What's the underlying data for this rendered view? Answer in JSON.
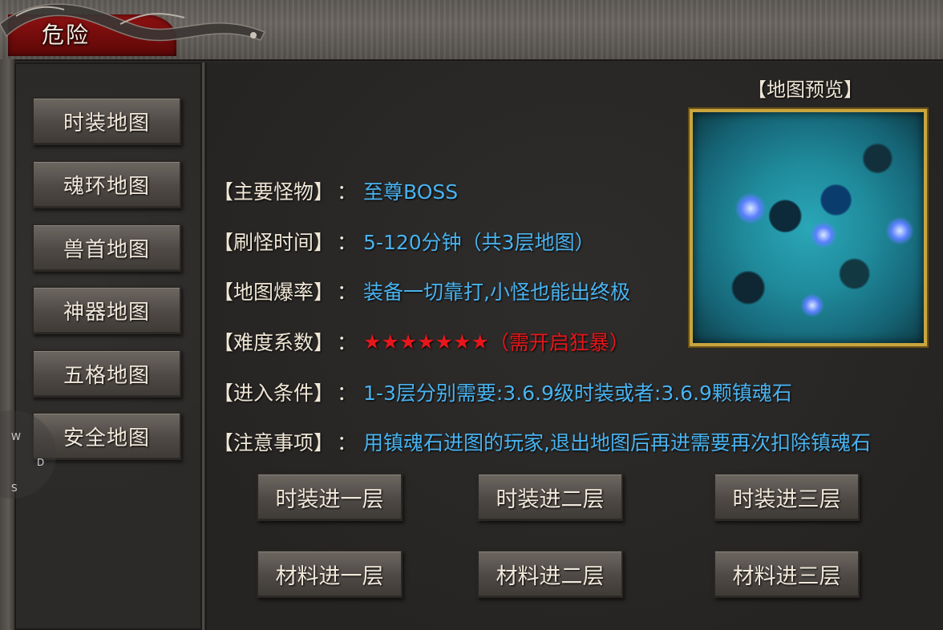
{
  "window": {
    "title": "危险"
  },
  "sidebar": {
    "items": [
      {
        "label": "时装地图"
      },
      {
        "label": "魂环地图"
      },
      {
        "label": "兽首地图"
      },
      {
        "label": "神器地图"
      },
      {
        "label": "五格地图"
      },
      {
        "label": "安全地图"
      }
    ]
  },
  "preview": {
    "label": "【地图预览】"
  },
  "info": {
    "monster": {
      "label": "【主要怪物】",
      "sep": "：",
      "value": "至尊BOSS"
    },
    "refresh": {
      "label": "【刷怪时间】",
      "sep": "：",
      "value": "5-120分钟（共3层地图）"
    },
    "drop": {
      "label": "【地图爆率】",
      "sep": "：",
      "value": "装备一切靠打,小怪也能出终极"
    },
    "difficulty": {
      "label": "【难度系数】",
      "sep": "：",
      "stars": "★★★★★★★",
      "note": "（需开启狂暴）",
      "star_count": 7
    },
    "entry": {
      "label": "【进入条件】",
      "sep": "：",
      "value": "1-3层分别需要:3.6.9级时装或者:3.6.9颗镇魂石"
    },
    "notice": {
      "label": "【注意事项】",
      "sep": "：",
      "value": "用镇魂石进图的玩家,退出地图后再进需要再次扣除镇魂石"
    }
  },
  "actions": {
    "fashion_1": "时装进一层",
    "fashion_2": "时装进二层",
    "fashion_3": "时装进三层",
    "material_1": "材料进一层",
    "material_2": "材料进二层",
    "material_3": "材料进三层"
  },
  "joystick": {
    "keys": {
      "w": "W",
      "d": "D",
      "s": "S"
    }
  },
  "colors": {
    "title_tab": "#8e1212",
    "value_blue": "#49b3f0",
    "star_red": "#e6161b",
    "map_border": "#c9a53f"
  }
}
